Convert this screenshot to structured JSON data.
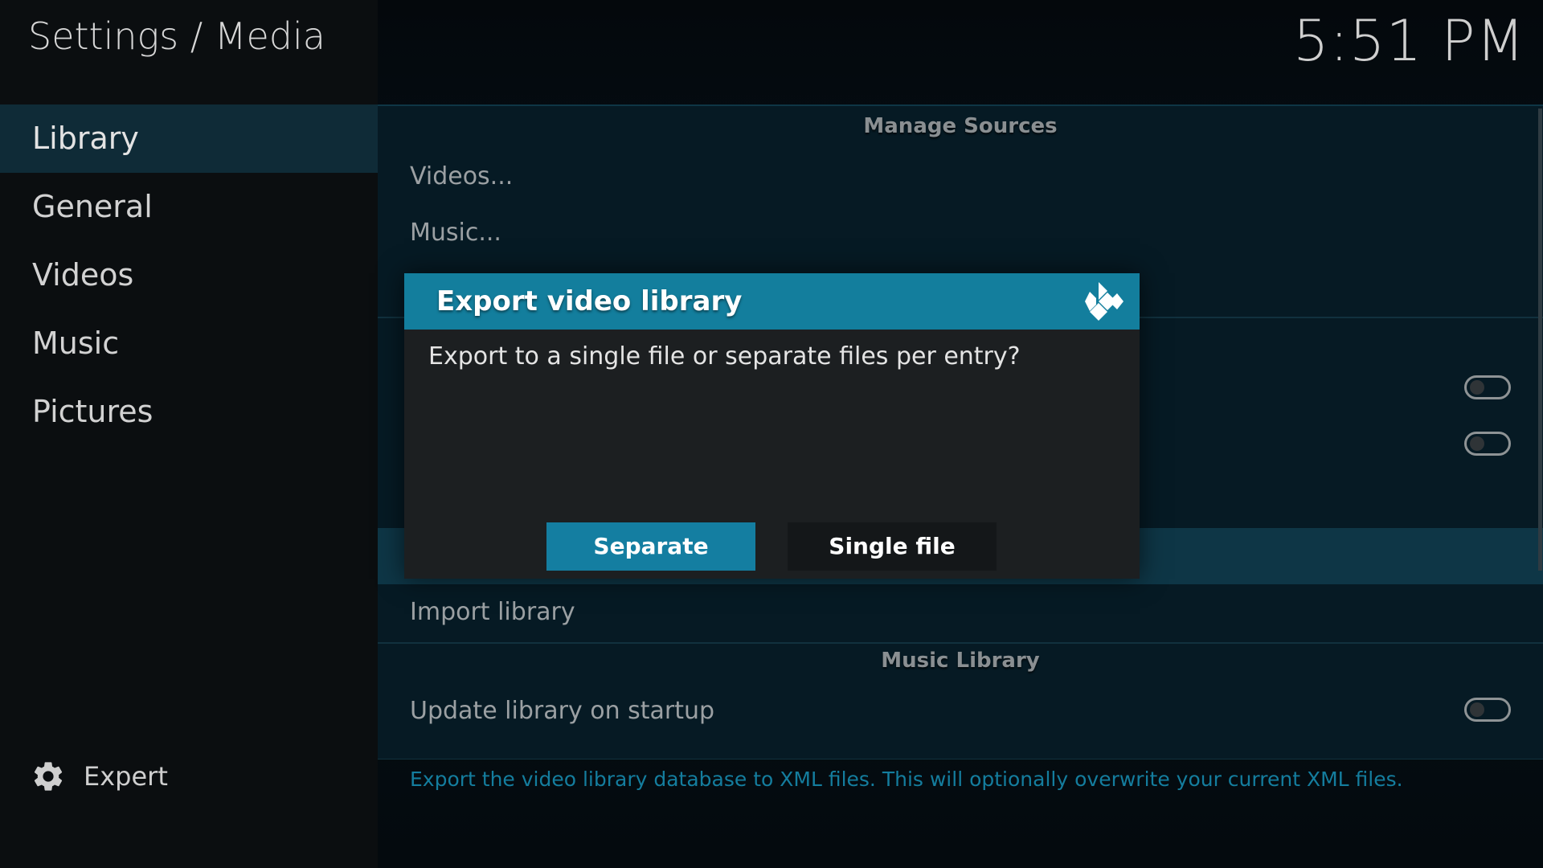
{
  "header": {
    "title": "Settings / Media",
    "clock": "5:51 PM"
  },
  "sidebar": {
    "items": [
      {
        "label": "Library",
        "active": true
      },
      {
        "label": "General",
        "active": false
      },
      {
        "label": "Videos",
        "active": false
      },
      {
        "label": "Music",
        "active": false
      },
      {
        "label": "Pictures",
        "active": false
      }
    ],
    "expert": {
      "label": "Expert",
      "icon": "gear-icon"
    }
  },
  "content": {
    "manage_sources_header": "Manage Sources",
    "rows": {
      "videos": "Videos...",
      "music": "Music...",
      "import_library": "Import library",
      "update_library_on_startup": "Update library on startup"
    },
    "music_library_header": "Music Library",
    "toggles": {
      "toggle_1": false,
      "toggle_2": false,
      "update_library_on_startup": false
    },
    "help_text": "Export the video library database to XML files. This will optionally overwrite your current XML files."
  },
  "dialog": {
    "title": "Export video library",
    "icon": "kodi-logo-icon",
    "message": "Export to a single file or separate files per entry?",
    "buttons": {
      "separate": "Separate",
      "single_file": "Single file"
    }
  },
  "colors": {
    "accent": "#137e9d",
    "sidebar_bg": "#0b0e10",
    "active_item_bg": "#0f2b37",
    "dialog_bg": "#1c1f21",
    "help_text": "#147d9e"
  }
}
